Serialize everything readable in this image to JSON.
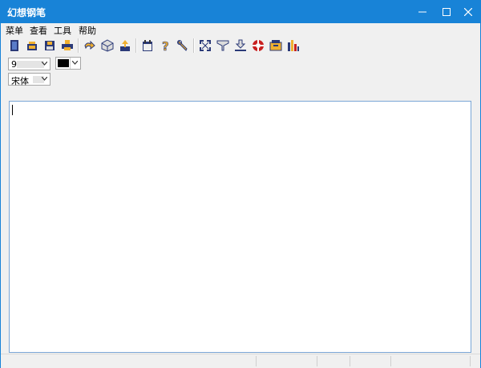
{
  "window": {
    "title": "幻想钢笔"
  },
  "menu": [
    {
      "label": "菜单"
    },
    {
      "label": "查看"
    },
    {
      "label": "工具"
    },
    {
      "label": "帮助"
    }
  ],
  "toolbar": {
    "buttons": [
      {
        "icon": "new-document-icon"
      },
      {
        "icon": "open-folder-icon"
      },
      {
        "icon": "save-icon"
      },
      {
        "icon": "print-icon"
      },
      {
        "icon": "undo-icon"
      },
      {
        "icon": "cube-icon"
      },
      {
        "icon": "export-icon"
      },
      {
        "icon": "calendar-icon"
      },
      {
        "icon": "help-icon"
      },
      {
        "icon": "wrench-icon"
      },
      {
        "icon": "fullscreen-icon"
      },
      {
        "icon": "filter-icon"
      },
      {
        "icon": "download-icon"
      },
      {
        "icon": "lifebuoy-icon"
      },
      {
        "icon": "archive-icon"
      },
      {
        "icon": "bar-chart-icon"
      }
    ]
  },
  "format": {
    "font_size": "9",
    "font_name": "宋体",
    "text_color": "#000000"
  },
  "colors": {
    "titlebar": "#1883d7",
    "editor_border": "#7aa6d6",
    "toolbar_icon_dark": "#2b3a78",
    "toolbar_icon_accent": "#f0b030"
  }
}
